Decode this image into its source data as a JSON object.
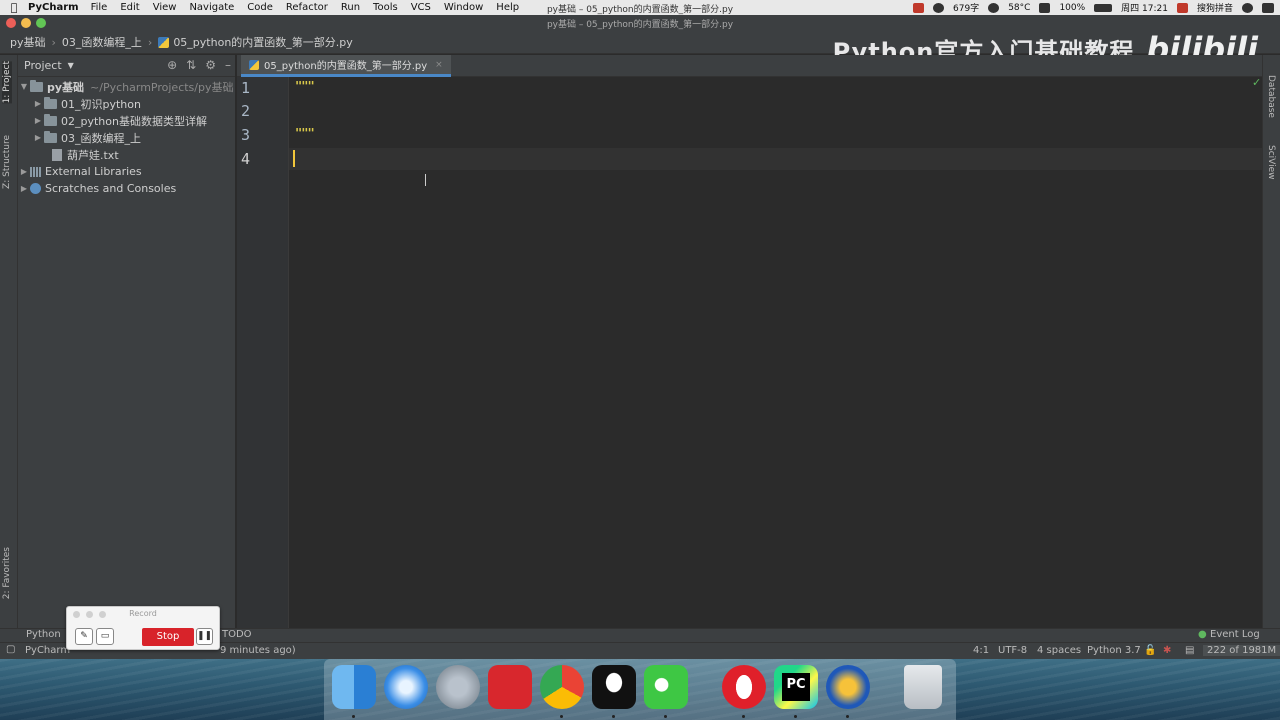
{
  "menubar": {
    "app_name": "PyCharm",
    "items": [
      "File",
      "Edit",
      "View",
      "Navigate",
      "Code",
      "Refactor",
      "Run",
      "Tools",
      "VCS",
      "Window",
      "Help"
    ],
    "tray": {
      "words": "679字",
      "battery": "100%",
      "clock": "周四 17:21",
      "ime": "搜狗拼音",
      "weather": "58°C"
    }
  },
  "window": {
    "title": "py基础 – 05_python的内置函数_第一部分.py"
  },
  "navbar": {
    "crumbs": [
      "py基础",
      "03_函数编程_上",
      "05_python的内置函数_第一部分.py"
    ]
  },
  "watermark": {
    "text": "Python官方入门基础教程",
    "logo": "bilibili"
  },
  "left_stripe": {
    "project": "1: Project",
    "structure": "Z: Structure",
    "favorites": "2: Favorites"
  },
  "right_stripe": {
    "database": "Database",
    "sciview": "SciView"
  },
  "project_panel": {
    "title": "Project",
    "root": {
      "name": "py基础",
      "path": "~/PycharmProjects/py基础"
    },
    "children": [
      "01_初识python",
      "02_python基础数据类型详解",
      "03_函数编程_上"
    ],
    "file": "葫芦娃.txt",
    "external": "External Libraries",
    "scratches": "Scratches and Consoles"
  },
  "editor": {
    "tab": "05_python的内置函数_第一部分.py",
    "line_numbers": [
      "1",
      "2",
      "3",
      "4"
    ],
    "lines": [
      "\"\"\"",
      "",
      "\"\"\"",
      ""
    ]
  },
  "bottom_bar": {
    "python_console": "Python",
    "todo": "TODO",
    "event_log": "Event Log"
  },
  "status": {
    "message_left": "PyCharm",
    "message_tail": "9 minutes ago)",
    "position": "4:1",
    "encoding": "UTF-8",
    "indent": "4 spaces",
    "interpreter": "Python 3.7",
    "memory": "222 of 1981M"
  },
  "recorder": {
    "title": "Record",
    "stop": "Stop"
  },
  "dock": {
    "apps": [
      "finder-icon",
      "safari-icon",
      "launchpad-icon",
      "netease-music-icon",
      "chrome-icon",
      "qq-icon",
      "wechat-icon",
      "opera-icon",
      "pycharm-icon",
      "app-lightning-icon",
      "trash-icon"
    ]
  }
}
